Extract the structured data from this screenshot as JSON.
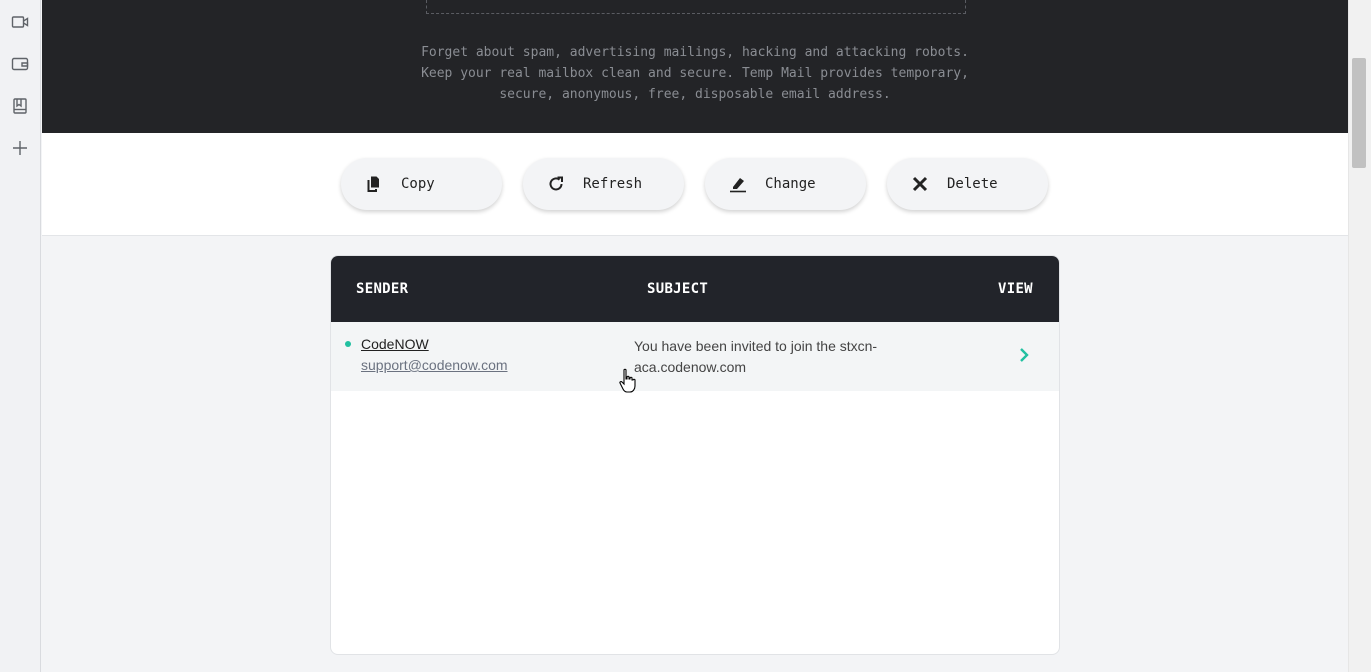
{
  "sidebar": {
    "items": [
      {
        "icon": "video-icon"
      },
      {
        "icon": "wallet-icon"
      },
      {
        "icon": "bookmark-icon"
      },
      {
        "icon": "add-icon"
      }
    ]
  },
  "hero": {
    "lines": [
      "Forget about spam, advertising mailings, hacking and attacking robots.",
      "Keep your real mailbox clean and secure. Temp Mail provides temporary,",
      "secure, anonymous, free, disposable email address."
    ]
  },
  "actions": {
    "copy": {
      "label": "Copy",
      "icon": "copy-icon"
    },
    "refresh": {
      "label": "Refresh",
      "icon": "refresh-icon"
    },
    "change": {
      "label": "Change",
      "icon": "edit-icon"
    },
    "delete": {
      "label": "Delete",
      "icon": "close-icon"
    }
  },
  "inbox": {
    "headers": {
      "sender": "SENDER",
      "subject": "SUBJECT",
      "view": "VIEW"
    },
    "rows": [
      {
        "sender_name": "CodeNOW",
        "sender_email": "support@codenow.com",
        "subject": "You have been invited to join the stxcn-aca.codenow.com",
        "unread": true
      }
    ]
  },
  "colors": {
    "hero_bg": "#232427",
    "table_header_bg": "#22242a",
    "accent": "#21c0a0"
  }
}
